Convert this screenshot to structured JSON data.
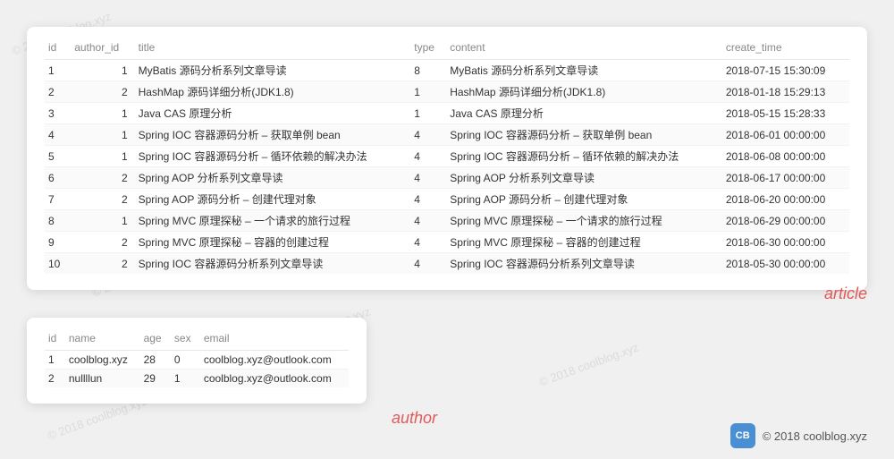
{
  "watermarks": [
    "© 2018 coolblog.xyz",
    "© 2018 coolblog.xyz",
    "© 2018 coolblog.xyz",
    "© 2018 coolblog.xyz",
    "© 2018 coolblog.xyz",
    "© 2018 coolblog.xyz",
    "© 2018 coolblog.xyz",
    "© 2018 coolblog.xyz"
  ],
  "article_table": {
    "headers": [
      "id",
      "author_id",
      "title",
      "type",
      "content",
      "create_time"
    ],
    "rows": [
      [
        "1",
        "1",
        "MyBatis 源码分析系列文章导读",
        "8",
        "MyBatis 源码分析系列文章导读",
        "2018-07-15 15:30:09"
      ],
      [
        "2",
        "2",
        "HashMap 源码详细分析(JDK1.8)",
        "1",
        "HashMap 源码详细分析(JDK1.8)",
        "2018-01-18 15:29:13"
      ],
      [
        "3",
        "1",
        "Java CAS 原理分析",
        "1",
        "Java CAS 原理分析",
        "2018-05-15 15:28:33"
      ],
      [
        "4",
        "1",
        "Spring IOC 容器源码分析 – 获取单例 bean",
        "4",
        "Spring IOC 容器源码分析 – 获取单例 bean",
        "2018-06-01 00:00:00"
      ],
      [
        "5",
        "1",
        "Spring IOC 容器源码分析 – 循环依赖的解决办法",
        "4",
        "Spring IOC 容器源码分析 – 循环依赖的解决办法",
        "2018-06-08 00:00:00"
      ],
      [
        "6",
        "2",
        "Spring AOP 分析系列文章导读",
        "4",
        "Spring AOP 分析系列文章导读",
        "2018-06-17 00:00:00"
      ],
      [
        "7",
        "2",
        "Spring AOP 源码分析 – 创建代理对象",
        "4",
        "Spring AOP 源码分析 – 创建代理对象",
        "2018-06-20 00:00:00"
      ],
      [
        "8",
        "1",
        "Spring MVC 原理探秘 – 一个请求的旅行过程",
        "4",
        "Spring MVC 原理探秘 – 一个请求的旅行过程",
        "2018-06-29 00:00:00"
      ],
      [
        "9",
        "2",
        "Spring MVC 原理探秘 – 容器的创建过程",
        "4",
        "Spring MVC 原理探秘 – 容器的创建过程",
        "2018-06-30 00:00:00"
      ],
      [
        "10",
        "2",
        "Spring IOC 容器源码分析系列文章导读",
        "4",
        "Spring IOC 容器源码分析系列文章导读",
        "2018-05-30 00:00:00"
      ]
    ]
  },
  "author_table": {
    "headers": [
      "id",
      "name",
      "age",
      "sex",
      "email"
    ],
    "rows": [
      [
        "1",
        "coolblog.xyz",
        "28",
        "0",
        "coolblog.xyz@outlook.com"
      ],
      [
        "2",
        "nullllun",
        "29",
        "1",
        "coolblog.xyz@outlook.com"
      ]
    ]
  },
  "labels": {
    "article": "article",
    "author": "author"
  },
  "footer": {
    "text": "© 2018 coolblog.xyz",
    "logo": "CB"
  }
}
